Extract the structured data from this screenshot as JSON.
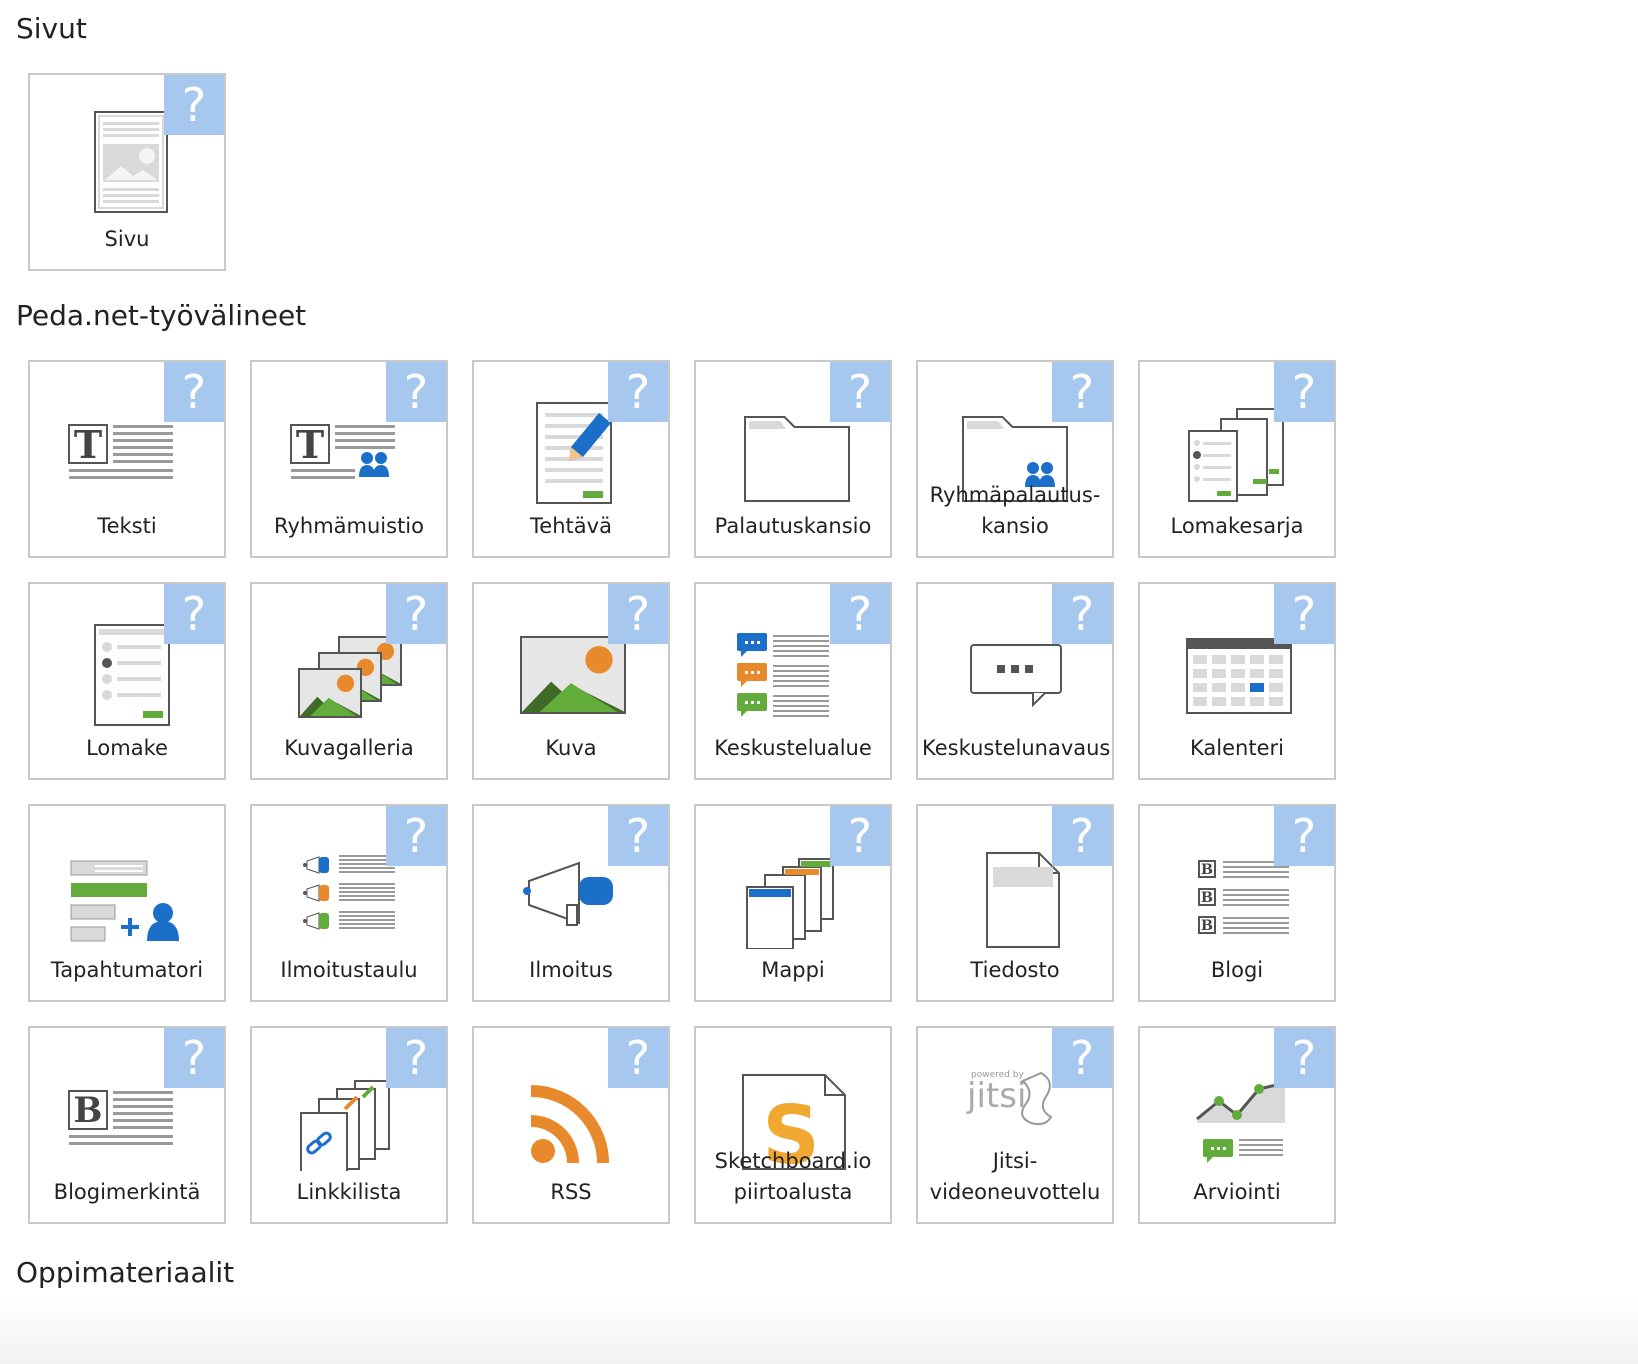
{
  "sections": {
    "pages": {
      "title": "Sivut"
    },
    "tools": {
      "title": "Peda.net-työvälineet"
    },
    "materials": {
      "title": "Oppimateriaalit"
    }
  },
  "help_symbol": "?",
  "pages": [
    {
      "label": "Sivu",
      "icon": "page-icon",
      "help": true
    }
  ],
  "tools": [
    {
      "label": "Teksti",
      "icon": "text-icon",
      "help": true
    },
    {
      "label": "Ryhmämuistio",
      "icon": "group-note-icon",
      "help": true
    },
    {
      "label": "Tehtävä",
      "icon": "assignment-icon",
      "help": true
    },
    {
      "label": "Palautuskansio",
      "icon": "folder-icon",
      "help": true
    },
    {
      "label": "Ryhmäpalautus-kansio",
      "icon": "group-folder-icon",
      "help": true
    },
    {
      "label": "Lomakesarja",
      "icon": "form-series-icon",
      "help": true
    },
    {
      "label": "Lomake",
      "icon": "form-icon",
      "help": true
    },
    {
      "label": "Kuvagalleria",
      "icon": "image-gallery-icon",
      "help": true
    },
    {
      "label": "Kuva",
      "icon": "image-icon",
      "help": true
    },
    {
      "label": "Keskustelualue",
      "icon": "discussion-area-icon",
      "help": true
    },
    {
      "label": "Keskustelunavaus",
      "icon": "chat-bubble-icon",
      "help": true
    },
    {
      "label": "Kalenteri",
      "icon": "calendar-icon",
      "help": true
    },
    {
      "label": "Tapahtumatori",
      "icon": "event-market-icon",
      "help": false
    },
    {
      "label": "Ilmoitustaulu",
      "icon": "bulletin-board-icon",
      "help": true
    },
    {
      "label": "Ilmoitus",
      "icon": "megaphone-icon",
      "help": true
    },
    {
      "label": "Mappi",
      "icon": "binder-icon",
      "help": true
    },
    {
      "label": "Tiedosto",
      "icon": "file-icon",
      "help": true
    },
    {
      "label": "Blogi",
      "icon": "blog-icon",
      "help": true
    },
    {
      "label": "Blogimerkintä",
      "icon": "blog-entry-icon",
      "help": true
    },
    {
      "label": "Linkkilista",
      "icon": "link-list-icon",
      "help": true
    },
    {
      "label": "RSS",
      "icon": "rss-icon",
      "help": true
    },
    {
      "label": "Sketchboard.io piirtoalusta",
      "icon": "sketchboard-icon",
      "help": false
    },
    {
      "label": "Jitsi-videoneuvottelu",
      "icon": "jitsi-icon",
      "help": true,
      "logo_text": "powered by jitsi"
    },
    {
      "label": "Arviointi",
      "icon": "assessment-icon",
      "help": true
    }
  ],
  "colors": {
    "help_bg": "#a6c8ee",
    "blue": "#1b6fc9",
    "orange": "#e8892b",
    "green": "#62ac3b",
    "gray": "#9a9a9a",
    "border": "#c8c8c8"
  }
}
